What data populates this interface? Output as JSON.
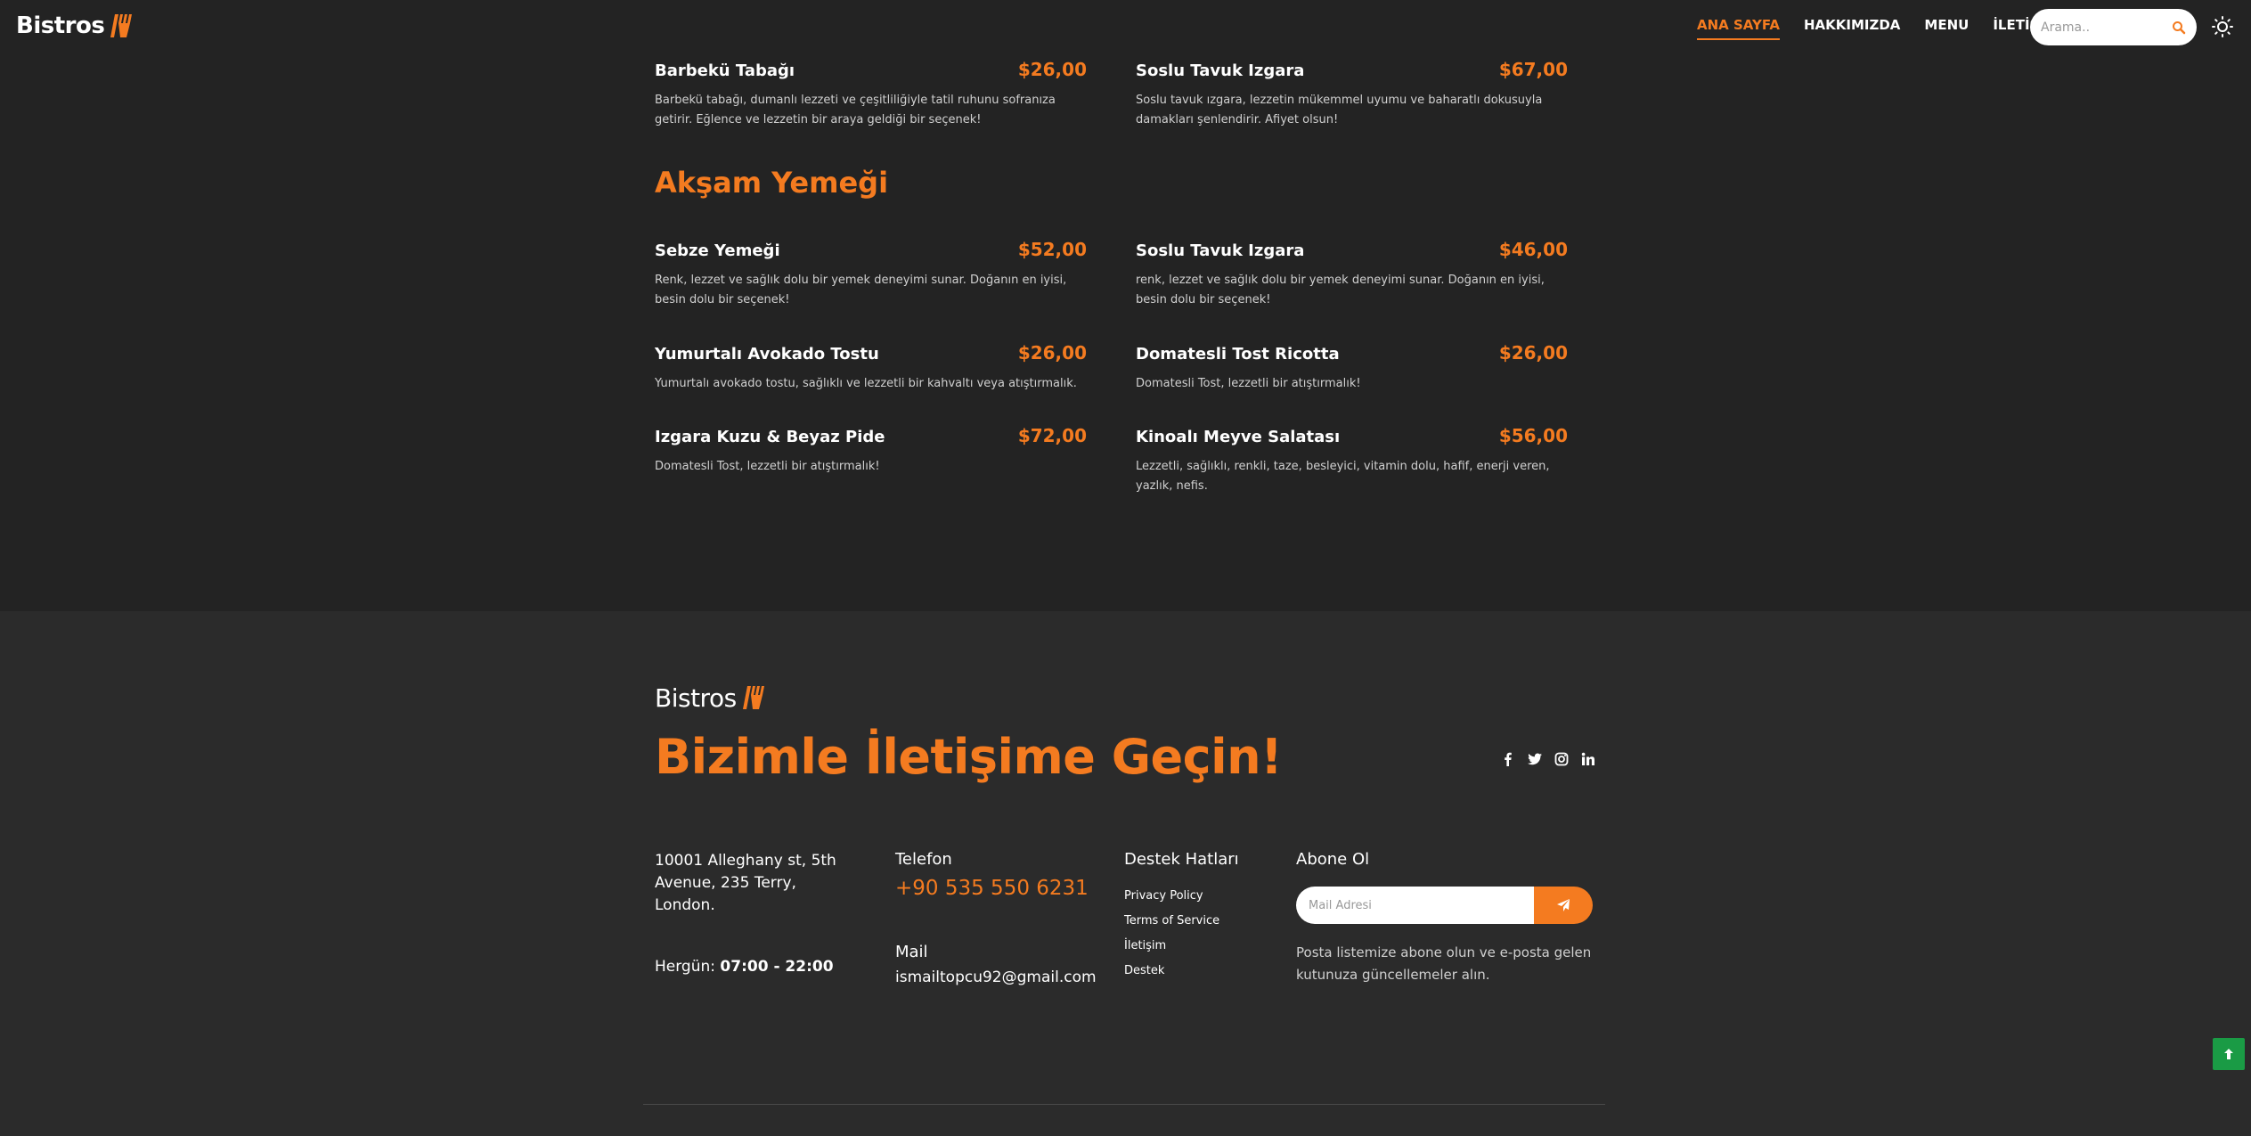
{
  "header": {
    "logo_text": "Bistros",
    "nav": [
      {
        "label": "ANA SAYFA",
        "active": true
      },
      {
        "label": "HAKKIMIZDA",
        "active": false
      },
      {
        "label": "MENU",
        "active": false
      },
      {
        "label": "İLETİŞİM",
        "active": false
      }
    ],
    "search_placeholder": "Arama.."
  },
  "menu": {
    "top_items": [
      {
        "name": "Barbekü Tabağı",
        "price": "$26,00",
        "desc": "Barbekü tabağı, dumanlı lezzeti ve çeşitliliğiyle tatil ruhunu sofranıza getirir. Eğlence ve lezzetin bir araya geldiği bir seçenek!"
      },
      {
        "name": "Soslu Tavuk Izgara",
        "price": "$67,00",
        "desc": "Soslu tavuk ızgara, lezzetin mükemmel uyumu ve baharatlı dokusuyla damakları şenlendirir. Afiyet olsun!"
      }
    ],
    "section_title": "Akşam Yemeği",
    "items": [
      {
        "name": "Sebze Yemeği",
        "price": "$52,00",
        "desc": "Renk, lezzet ve sağlık dolu bir yemek deneyimi sunar. Doğanın en iyisi, besin dolu bir seçenek!"
      },
      {
        "name": "Soslu Tavuk Izgara",
        "price": "$46,00",
        "desc": "renk, lezzet ve sağlık dolu bir yemek deneyimi sunar. Doğanın en iyisi, besin dolu bir seçenek!"
      },
      {
        "name": "Yumurtalı Avokado Tostu",
        "price": "$26,00",
        "desc": "Yumurtalı avokado tostu, sağlıklı ve lezzetli bir kahvaltı veya atıştırmalık."
      },
      {
        "name": "Domatesli Tost Ricotta",
        "price": "$26,00",
        "desc": "Domatesli Tost, lezzetli bir atıştırmalık!"
      },
      {
        "name": "Izgara Kuzu & Beyaz Pide",
        "price": "$72,00",
        "desc": "Domatesli Tost, lezzetli bir atıştırmalık!"
      },
      {
        "name": "Kinoalı Meyve Salatası",
        "price": "$56,00",
        "desc": "Lezzetli, sağlıklı, renkli, taze, besleyici, vitamin dolu, hafif, enerji veren, yazlık, nefis."
      }
    ]
  },
  "footer": {
    "logo_text": "Bistros",
    "title": "Bizimle İletişime Geçin!",
    "socials": [
      "facebook-icon",
      "twitter-icon",
      "instagram-icon",
      "linkedin-icon"
    ],
    "address": "10001 Alleghany st, 5th Avenue, 235 Terry, London.",
    "hours_label": "Hergün:",
    "hours_value": "07:00 - 22:00",
    "phone_title": "Telefon",
    "phone_value": "+90 535 550 6231",
    "mail_title": "Mail",
    "mail_value": "ismailtopcu92@gmail.com",
    "support_title": "Destek Hatları",
    "support_links": [
      "Privacy Policy",
      "Terms of Service",
      "İletişim",
      "Destek"
    ],
    "subscribe_title": "Abone Ol",
    "subscribe_placeholder": "Mail Adresi",
    "subscribe_note": "Posta listemize abone olun ve e-posta gelen kutunuza güncellemeler alın."
  },
  "colors": {
    "accent": "#f47b20",
    "background": "#232323",
    "footer_bg": "#2b2b2b",
    "back_to_top": "#1a9b45"
  }
}
